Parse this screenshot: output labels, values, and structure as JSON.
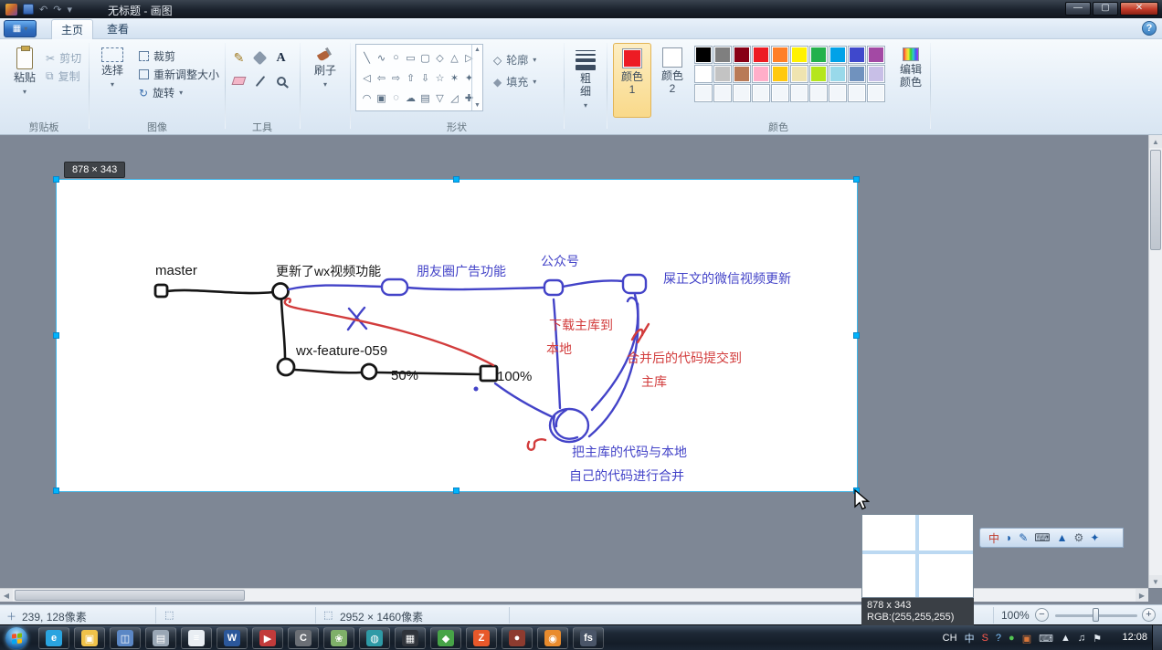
{
  "titlebar": {
    "title": "无标题 - 画图"
  },
  "tabs": {
    "home": "主页",
    "view": "查看"
  },
  "ribbon": {
    "clipboard": {
      "paste": "粘贴",
      "cut": "剪切",
      "copy": "复制",
      "group_label": "剪贴板"
    },
    "image": {
      "select": "选择",
      "crop": "裁剪",
      "resize": "重新调整大小",
      "rotate": "旋转",
      "group_label": "图像"
    },
    "tools": {
      "group_label": "工具",
      "text_tool": "A"
    },
    "brushes": {
      "label": "刷子"
    },
    "shapes": {
      "group_label": "形状",
      "outline": "轮廓",
      "fill": "填充",
      "glyphs": [
        "╲",
        "∿",
        "○",
        "▭",
        "▢",
        "◇",
        "△",
        "▷",
        "◁",
        "⇦",
        "⇨",
        "⇧",
        "⇩",
        "☆",
        "✶",
        "✦",
        "◠",
        "▣",
        "◌",
        "☁",
        "▤",
        "▽",
        "◿",
        "✚"
      ]
    },
    "size": {
      "label": "粗细"
    },
    "colors": {
      "group_label": "颜色",
      "color1_label": "颜色1",
      "color2_label": "颜色2",
      "edit_label": "编辑颜色",
      "color1_value": "#ED1C24",
      "color2_value": "#FFFFFF",
      "palette": [
        "#000000",
        "#7F7F7F",
        "#880015",
        "#ED1C24",
        "#FF7F27",
        "#FFF200",
        "#22B14C",
        "#00A2E8",
        "#3F48CC",
        "#A349A4",
        "#FFFFFF",
        "#C3C3C3",
        "#B97A57",
        "#FFAEC9",
        "#FFC90E",
        "#EFE4B0",
        "#B5E61D",
        "#99D9EA",
        "#7092BE",
        "#C8BFE7",
        "",
        "",
        "",
        "",
        "",
        "",
        "",
        "",
        "",
        ""
      ]
    }
  },
  "canvas": {
    "selection_tooltip": "878 × 343",
    "labels": {
      "master": "master",
      "feature_update": "更新了wx视频功能",
      "moments_ads": "朋友圈广告功能",
      "official_account": "公众号",
      "video_update": "屎正文的微信视频更新",
      "branch_name": "wx-feature-059",
      "progress_50": "50%",
      "progress_100": "100%",
      "download_line1": "下载主库到",
      "download_line2": "本地",
      "commit_line1": "合并后的代码提交到",
      "commit_line2": "主库",
      "merge_line1": "把主库的代码与本地",
      "merge_line2": "自己的代码进行合并"
    }
  },
  "diagram_colors": {
    "branch_black": "#151515",
    "flow_blue": "#4343c8",
    "note_red": "#d23c3c"
  },
  "statusbar": {
    "position": "239, 128像素",
    "selection_size": "",
    "image_size": "2952 × 1460像素",
    "zoom": "100%"
  },
  "magnifier": {
    "size_label": "878 x 343",
    "rgb_label": "RGB:(255,255,255)"
  },
  "langbar": {
    "icons": [
      {
        "g": "中",
        "c": "#c03a2b"
      },
      {
        "g": "◗",
        "c": "#1a5dab"
      },
      {
        "g": "✎",
        "c": "#1a5dab"
      },
      {
        "g": "⌨",
        "c": "#3a4654"
      },
      {
        "g": "▲",
        "c": "#1a5dab"
      },
      {
        "g": "⚙",
        "c": "#5a6673"
      },
      {
        "g": "✦",
        "c": "#1a5dab"
      }
    ]
  },
  "taskbar": {
    "time": "12:08",
    "apps": [
      {
        "c": "#2aa4e0",
        "g": "e"
      },
      {
        "c": "#f0c24a",
        "g": "▣"
      },
      {
        "c": "#5b87c5",
        "g": "◫"
      },
      {
        "c": "#9aa7b5",
        "g": "▤"
      },
      {
        "c": "#e9eef3",
        "g": "≡"
      },
      {
        "c": "#2b579a",
        "g": "W"
      },
      {
        "c": "#c23b3b",
        "g": "▶"
      },
      {
        "c": "#6b6f75",
        "g": "C"
      },
      {
        "c": "#7fb069",
        "g": "❀"
      },
      {
        "c": "#2e9aa6",
        "g": "◍"
      },
      {
        "c": "#30343b",
        "g": "▦"
      },
      {
        "c": "#47a447",
        "g": "◆"
      },
      {
        "c": "#e8582a",
        "g": "Z"
      },
      {
        "c": "#8d3b2f",
        "g": "●"
      },
      {
        "c": "#e98b2d",
        "g": "◉"
      },
      {
        "c": "#4a5568",
        "g": "fs"
      }
    ],
    "tray": [
      {
        "g": "CH",
        "c": "#f0f4f8"
      },
      {
        "g": "中",
        "c": "#bfe0ff"
      },
      {
        "g": "S",
        "c": "#ff5a4e"
      },
      {
        "g": "?",
        "c": "#7fc4ff"
      },
      {
        "g": "●",
        "c": "#52c452"
      },
      {
        "g": "▣",
        "c": "#d8763a"
      },
      {
        "g": "⌨",
        "c": "#cfd8e2"
      },
      {
        "g": "▲",
        "c": "#e4ebf2"
      },
      {
        "g": "♫",
        "c": "#e4ebf2"
      },
      {
        "g": "⚑",
        "c": "#e4ebf2"
      }
    ]
  }
}
